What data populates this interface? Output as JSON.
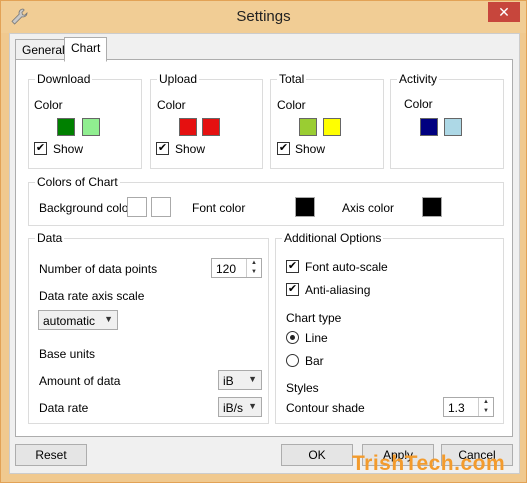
{
  "window": {
    "title": "Settings",
    "close_label": "✕"
  },
  "tabs": [
    {
      "label": "General"
    },
    {
      "label": "Chart"
    }
  ],
  "traffic_groups": [
    {
      "title": "Download",
      "color_label": "Color",
      "show_label": "Show",
      "show_checked": true,
      "colors": [
        "#008000",
        "#90ee90"
      ]
    },
    {
      "title": "Upload",
      "color_label": "Color",
      "show_label": "Show",
      "show_checked": true,
      "colors": [
        "#e51010",
        "#e51010"
      ]
    },
    {
      "title": "Total",
      "color_label": "Color",
      "show_label": "Show",
      "show_checked": true,
      "colors": [
        "#9acd32",
        "#ffff00"
      ]
    },
    {
      "title": "Activity",
      "color_label": "Color",
      "colors": [
        "#000080",
        "#add8e6"
      ]
    }
  ],
  "chart_colors": {
    "title": "Colors of Chart",
    "background_label": "Background color",
    "background_colors": [
      "#ffffff",
      "#ffffff"
    ],
    "font_label": "Font color",
    "font_color": "#000000",
    "axis_label": "Axis color",
    "axis_color": "#000000"
  },
  "data_group": {
    "title": "Data",
    "points_label": "Number of data points",
    "points_value": "120",
    "axis_scale_label": "Data rate axis scale",
    "axis_scale_value": "automatic",
    "base_units_label": "Base units",
    "amount_label": "Amount of data",
    "amount_value": "iB",
    "rate_label": "Data rate",
    "rate_value": "iB/s"
  },
  "options_group": {
    "title": "Additional Options",
    "font_autoscale_label": "Font auto-scale",
    "antialias_label": "Anti-aliasing",
    "chart_type_label": "Chart type",
    "line_label": "Line",
    "bar_label": "Bar",
    "styles_label": "Styles",
    "contour_label": "Contour shade",
    "contour_value": "1.3"
  },
  "buttons": {
    "reset": "Reset",
    "ok": "OK",
    "apply": "Apply",
    "cancel": "Cancel"
  },
  "watermark": "TrishTech.com",
  "check_glyph": "✔"
}
